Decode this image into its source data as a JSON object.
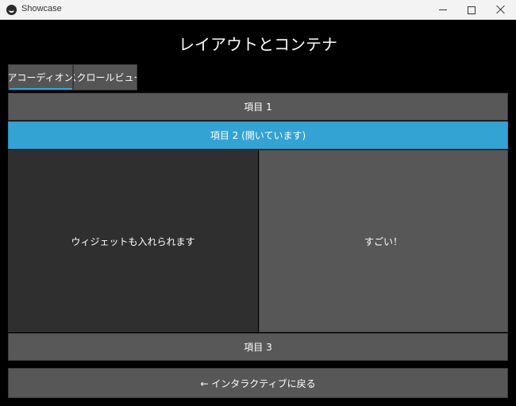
{
  "window": {
    "title": "Showcase",
    "icon": "kivy-logo-icon"
  },
  "page": {
    "title": "レイアウトとコンテナ"
  },
  "tabs": [
    {
      "label": "アコーディオン",
      "active": true
    },
    {
      "label": "スクロールビュー",
      "active": false
    }
  ],
  "accordion": {
    "items": [
      {
        "label": "項目 1",
        "open": false
      },
      {
        "label": "項目 2 (開いています)",
        "open": true
      },
      {
        "label": "項目 3",
        "open": false
      }
    ],
    "open_content": {
      "left": "ウィジェットも入れられます",
      "right": "すごい！"
    }
  },
  "back_button": {
    "label": "← インタラクティブに戻る"
  },
  "colors": {
    "accent": "#33a3d3",
    "button": "#585858",
    "background": "#000000"
  }
}
